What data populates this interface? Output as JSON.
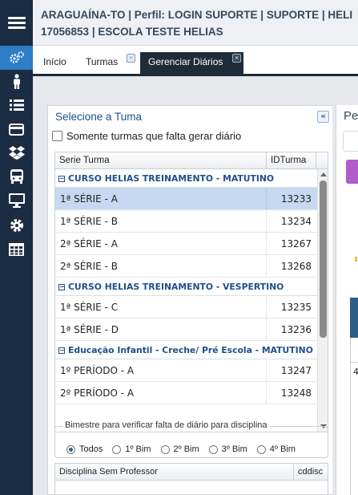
{
  "header": {
    "line1": "ARAGUAÍNA-TO | Perfil: LOGIN SUPORTE | SUPORTE | HELI",
    "line2": "17056853 | ESCOLA TESTE HELIAS"
  },
  "sidebar": {
    "icons": [
      "settings-gears-icon",
      "person-icon",
      "list-icon",
      "card-icon",
      "dropbox-icon",
      "bus-icon",
      "monitor-icon",
      "gear-icon",
      "table-icon"
    ]
  },
  "tabs": [
    {
      "label": "Início"
    },
    {
      "label": "Turmas"
    },
    {
      "label": "Gerenciar Diários"
    }
  ],
  "panel": {
    "title": "Selecione a Tuma",
    "collapse_symbol": "«",
    "only_missing_label": "Somente turmas que falta gerar diário"
  },
  "grid": {
    "columns": [
      "Serie Turma",
      "IDTurma"
    ],
    "groups": [
      {
        "name": "CURSO HELIAS TREINAMENTO - MATUTINO",
        "rows": [
          {
            "serie": "1ª SÉRIE - A",
            "id": "13233",
            "selected": true
          },
          {
            "serie": "1ª SÉRIE - B",
            "id": "13234"
          },
          {
            "serie": "2ª SÉRIE - A",
            "id": "13267"
          },
          {
            "serie": "2ª SÉRIE - B",
            "id": "13268"
          }
        ]
      },
      {
        "name": "CURSO HELIAS TREINAMENTO - VESPERTINO",
        "rows": [
          {
            "serie": "1ª SÉRIE - C",
            "id": "13235"
          },
          {
            "serie": "1ª SÉRIE - D",
            "id": "13236"
          }
        ]
      },
      {
        "name": "Educação Infantil - Creche/ Pré Escola - MATUTINO",
        "rows": [
          {
            "serie": "1º PERÍODO - A",
            "id": "13247"
          },
          {
            "serie": "2º PERÍODO - A",
            "id": "13248"
          }
        ]
      }
    ]
  },
  "bimestre": {
    "legend": "Bimestre para verificar falta de diário para disciplina",
    "options": [
      "Todos",
      "1º Bim",
      "2º Bim",
      "3º Bim",
      "4º Bim"
    ],
    "selected": "Todos"
  },
  "grid2": {
    "columns": [
      "Disciplina Sem Professor",
      "cddisc"
    ]
  },
  "right_panel": {
    "title_partial": "Pe",
    "number_partial": "4"
  },
  "colors": {
    "sidebar_bg": "#1b2d42",
    "sidebar_active": "#2d7ec4",
    "tab_active": "#1e2c3a",
    "group_text": "#1f4f8a",
    "selected_row": "#c6d9f0",
    "purple_button": "#b05cc9"
  }
}
